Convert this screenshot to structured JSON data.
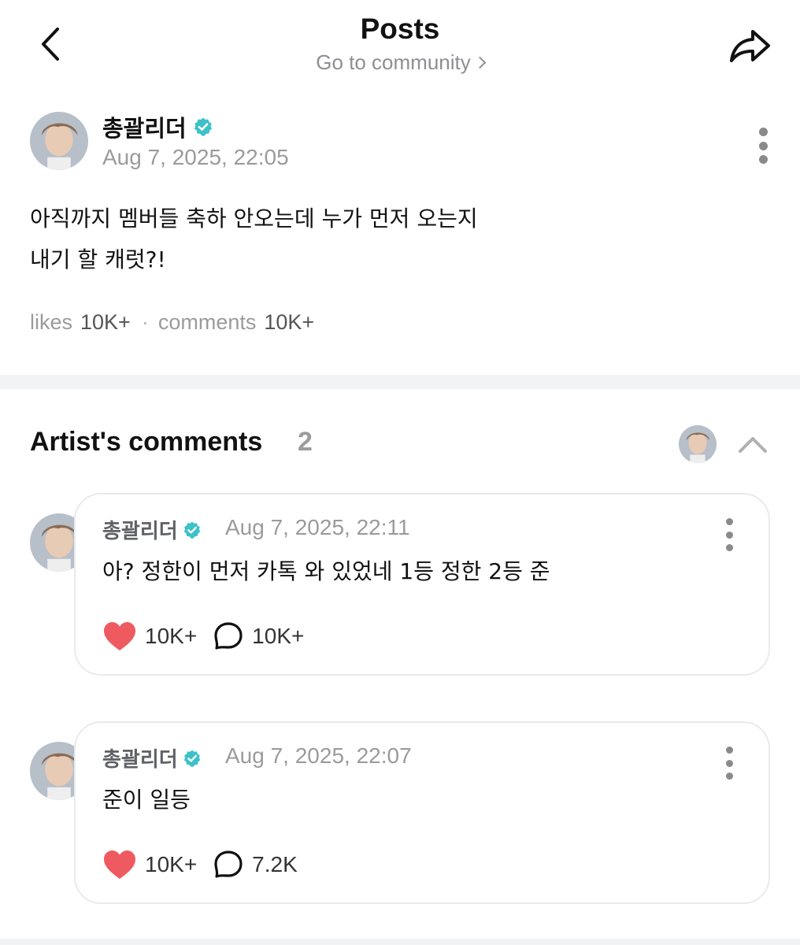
{
  "header": {
    "title": "Posts",
    "community_link": "Go to community"
  },
  "post": {
    "author": "총괄리더",
    "verified": true,
    "date": "Aug 7, 2025, 22:05",
    "body_lines": [
      "아직까지 멤버들 축하 안오는데 누가 먼저 오는지",
      "내기 할 캐럿?!"
    ],
    "stats": {
      "likes_label": "likes",
      "likes_value": "10K+",
      "separator": "·",
      "comments_label": "comments",
      "comments_value": "10K+"
    }
  },
  "artist_comments": {
    "title": "Artist's comments",
    "count": "2",
    "items": [
      {
        "author": "총괄리더",
        "date": "Aug 7, 2025, 22:11",
        "text": "아? 정한이 먼저 카톡 와 있었네 1등 정한 2등 준",
        "likes": "10K+",
        "replies": "10K+"
      },
      {
        "author": "총괄리더",
        "date": "Aug 7, 2025, 22:07",
        "text": "준이 일등",
        "likes": "10K+",
        "replies": "7.2K"
      }
    ]
  },
  "colors": {
    "verified_badge": "#3cc1c8",
    "heart": "#ee5a5f",
    "muted_text": "#9b9b9b",
    "divider": "#f2f3f5"
  },
  "icons": {
    "back": "chevron-left-icon",
    "share": "share-arrow-icon",
    "more": "more-vertical-icon",
    "collapse": "chevron-up-icon",
    "like": "heart-icon",
    "reply": "speech-bubble-icon",
    "verified": "verified-badge-icon"
  }
}
